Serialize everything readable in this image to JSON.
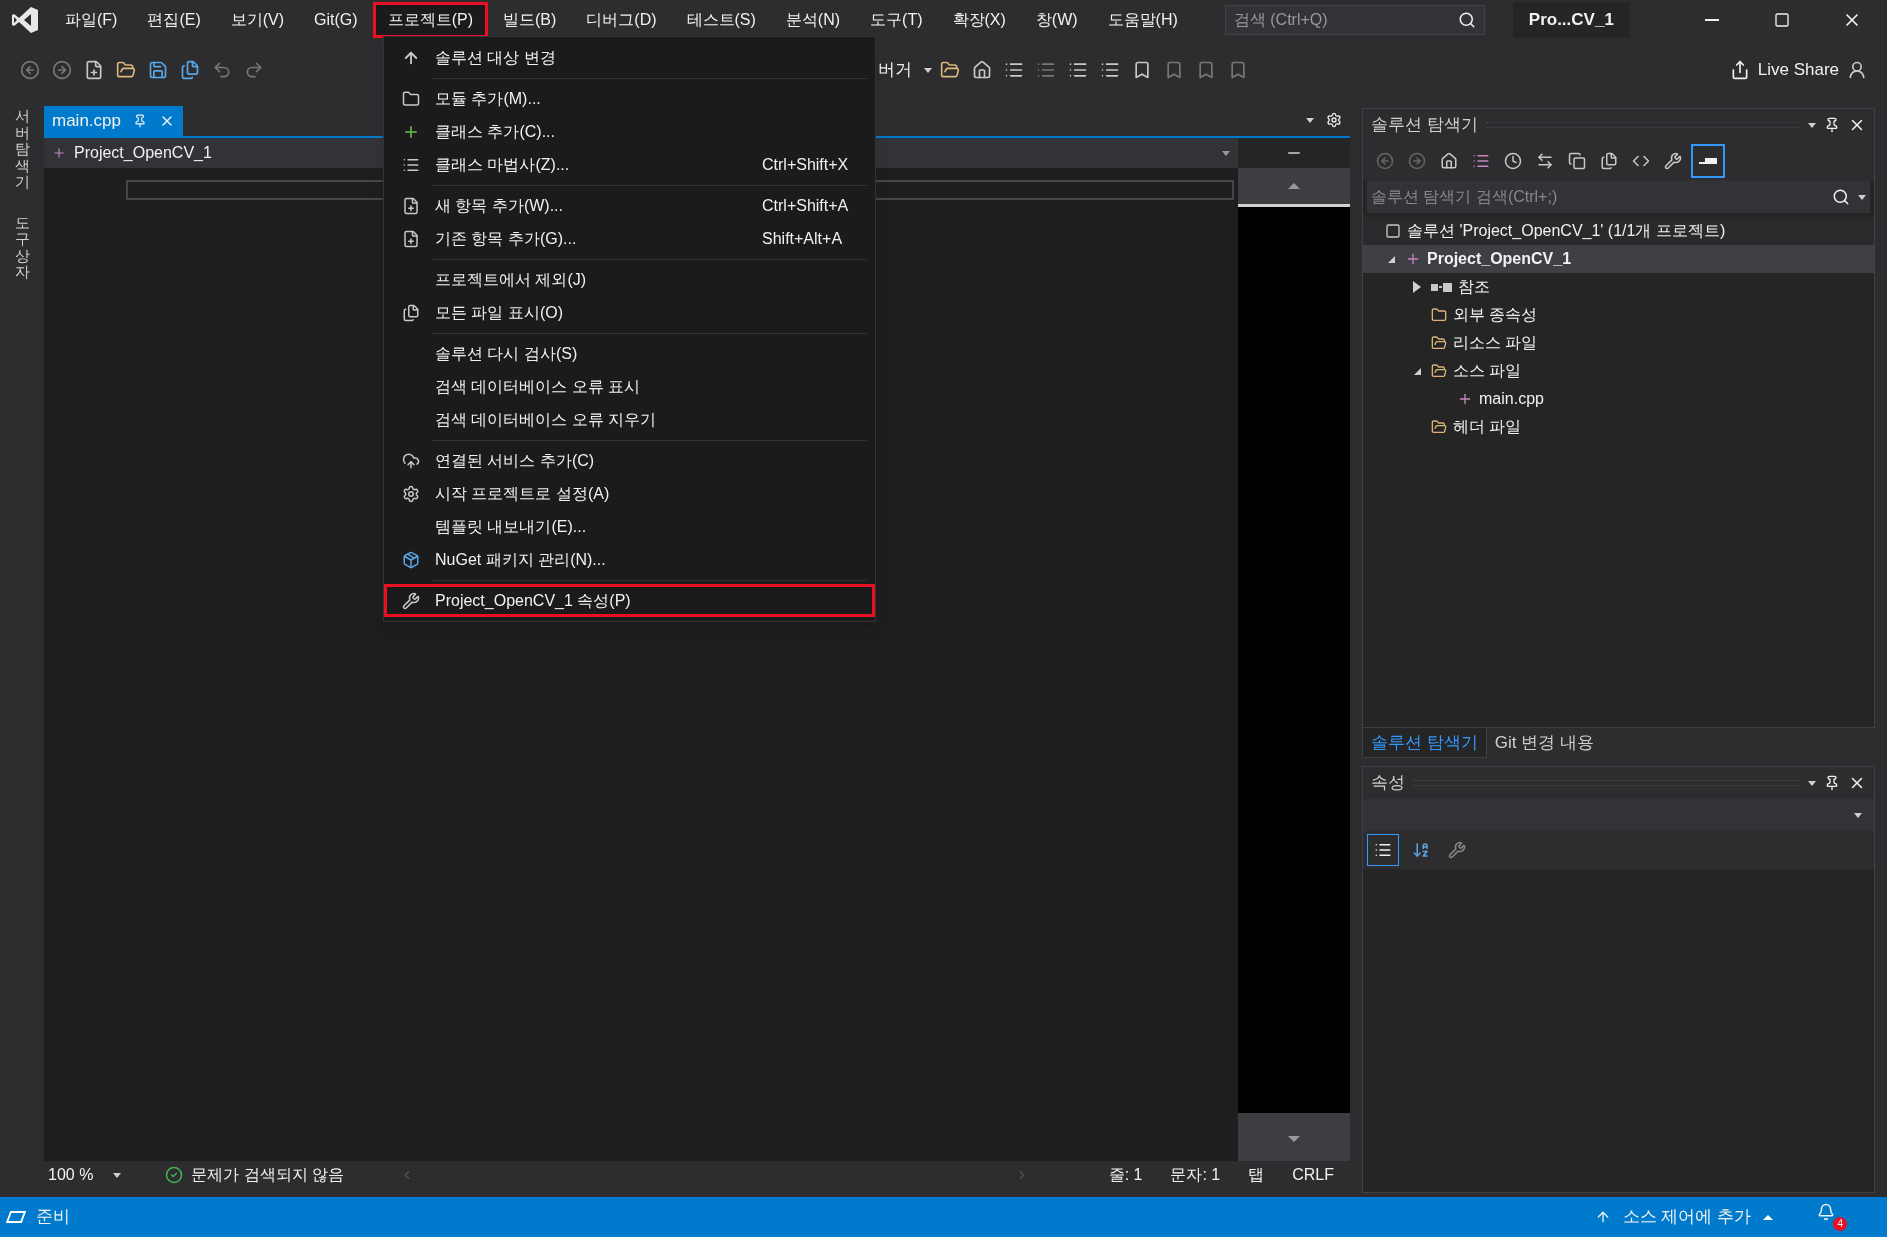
{
  "menu_bar": {
    "items": [
      {
        "label": "파일(F)",
        "selected": false,
        "highlighted": false
      },
      {
        "label": "편집(E)",
        "selected": false,
        "highlighted": false
      },
      {
        "label": "보기(V)",
        "selected": false,
        "highlighted": false
      },
      {
        "label": "Git(G)",
        "selected": false,
        "highlighted": false
      },
      {
        "label": "프로젝트(P)",
        "selected": true,
        "highlighted": true
      },
      {
        "label": "빌드(B)",
        "selected": false,
        "highlighted": false
      },
      {
        "label": "디버그(D)",
        "selected": false,
        "highlighted": false
      },
      {
        "label": "테스트(S)",
        "selected": false,
        "highlighted": false
      },
      {
        "label": "분석(N)",
        "selected": false,
        "highlighted": false
      },
      {
        "label": "도구(T)",
        "selected": false,
        "highlighted": false
      },
      {
        "label": "확장(X)",
        "selected": false,
        "highlighted": false
      },
      {
        "label": "창(W)",
        "selected": false,
        "highlighted": false
      },
      {
        "label": "도움말(H)",
        "selected": false,
        "highlighted": false
      }
    ],
    "search": {
      "placeholder": "검색 (Ctrl+Q)"
    },
    "title": "Pro...CV_1"
  },
  "toolbar": {
    "debugger_combo": "버거",
    "live_share": "Live Share"
  },
  "side_tabs": [
    "서버 탐색기",
    "도구 상자"
  ],
  "editor": {
    "tabs": [
      {
        "label": "main.cpp",
        "selected": true
      }
    ],
    "nav_combo": "Project_OpenCV_1",
    "zoom": "100 %",
    "issues": "문제가 검색되지 않음",
    "line": "줄: 1",
    "column": "문자: 1",
    "indent": "탭",
    "line_ending": "CRLF"
  },
  "project_menu": {
    "items": [
      {
        "kind": "item",
        "label": "솔루션 대상 변경",
        "highlighted": false
      },
      {
        "kind": "separator"
      },
      {
        "kind": "item",
        "label": "모듈 추가(M)...",
        "highlighted": false
      },
      {
        "kind": "item",
        "label": "클래스 추가(C)...",
        "highlighted": false
      },
      {
        "kind": "item",
        "label": "클래스 마법사(Z)...",
        "shortcut": "Ctrl+Shift+X",
        "highlighted": false
      },
      {
        "kind": "separator"
      },
      {
        "kind": "item",
        "label": "새 항목 추가(W)...",
        "shortcut": "Ctrl+Shift+A",
        "highlighted": false
      },
      {
        "kind": "item",
        "label": "기존 항목 추가(G)...",
        "shortcut": "Shift+Alt+A",
        "highlighted": false
      },
      {
        "kind": "separator"
      },
      {
        "kind": "item",
        "label": "프로젝트에서 제외(J)",
        "highlighted": false
      },
      {
        "kind": "item",
        "label": "모든 파일 표시(O)",
        "highlighted": false
      },
      {
        "kind": "separator"
      },
      {
        "kind": "item",
        "label": "솔루션 다시 검사(S)",
        "highlighted": false
      },
      {
        "kind": "item",
        "label": "검색 데이터베이스 오류 표시",
        "highlighted": false
      },
      {
        "kind": "item",
        "label": "검색 데이터베이스 오류 지우기",
        "highlighted": false
      },
      {
        "kind": "separator"
      },
      {
        "kind": "item",
        "label": "연결된 서비스 추가(C)",
        "highlighted": false
      },
      {
        "kind": "item",
        "label": "시작 프로젝트로 설정(A)",
        "highlighted": false
      },
      {
        "kind": "item",
        "label": "템플릿 내보내기(E)...",
        "highlighted": false
      },
      {
        "kind": "item",
        "label": "NuGet 패키지 관리(N)...",
        "highlighted": false
      },
      {
        "kind": "separator"
      },
      {
        "kind": "item",
        "label": "Project_OpenCV_1 속성(P)",
        "highlighted": true
      }
    ]
  },
  "solution_explorer": {
    "title": "솔루션 탐색기",
    "search": {
      "placeholder": "솔루션 탐색기 검색(Ctrl+;)"
    },
    "tree": {
      "kind": "solution",
      "label": "솔루션 'Project_OpenCV_1' (1/1개 프로젝트)",
      "selected": false,
      "children": [
        {
          "kind": "project",
          "label": "Project_OpenCV_1",
          "selected": true,
          "expanded": true,
          "children": [
            {
              "kind": "references",
              "label": "참조",
              "selected": false,
              "expanded": false
            },
            {
              "kind": "external",
              "label": "외부 종속성",
              "selected": false
            },
            {
              "kind": "filter",
              "label": "리소스 파일",
              "selected": false
            },
            {
              "kind": "filter",
              "label": "소스 파일",
              "selected": false,
              "expanded": true,
              "children": [
                {
                  "kind": "cpp",
                  "label": "main.cpp",
                  "selected": false
                }
              ]
            },
            {
              "kind": "filter",
              "label": "헤더 파일",
              "selected": false
            }
          ]
        }
      ]
    },
    "tabs": [
      {
        "label": "솔루션 탐색기",
        "selected": true
      },
      {
        "label": "Git 변경 내용",
        "selected": false
      }
    ]
  },
  "properties": {
    "title": "속성"
  },
  "status_bar": {
    "ready": "준비",
    "source_control": "소스 제어에 추가",
    "notifications": "4"
  }
}
